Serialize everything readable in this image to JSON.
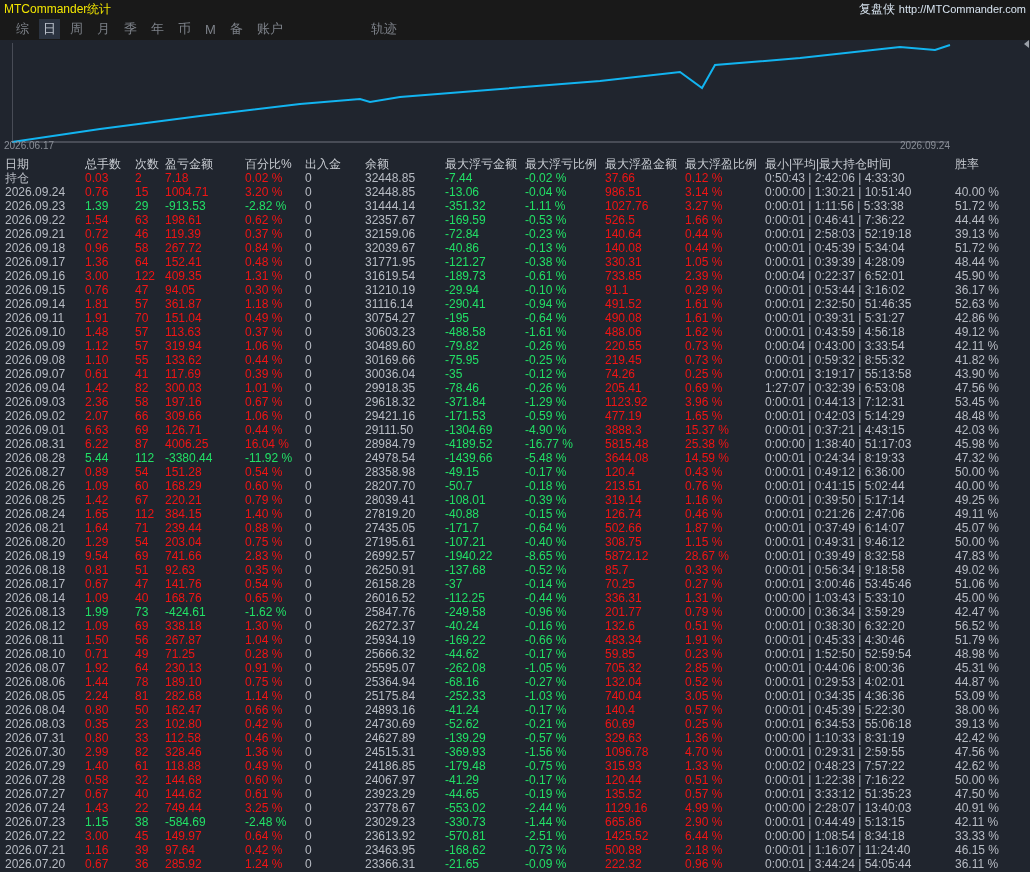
{
  "title": "MTCommander统计",
  "site": {
    "brand": "复盘侠",
    "url": "http://MTCommander.com"
  },
  "tabs": [
    {
      "label": "综",
      "selected": false
    },
    {
      "label": "日",
      "selected": true
    },
    {
      "label": "周",
      "selected": false
    },
    {
      "label": "月",
      "selected": false
    },
    {
      "label": "季",
      "selected": false
    },
    {
      "label": "年",
      "selected": false
    },
    {
      "label": "币",
      "selected": false
    },
    {
      "label": "M",
      "selected": false
    },
    {
      "label": "备",
      "selected": false
    },
    {
      "label": "账户",
      "selected": false
    },
    {
      "label": "轨迹",
      "selected": false
    }
  ],
  "equity_chart": {
    "start_label": "2026.06.17",
    "end_label": "2026.09.24"
  },
  "table": {
    "columns": [
      "日期",
      "总手数",
      "次数",
      "盈亏金额",
      "百分比%",
      "出入金",
      "余额",
      "最大浮亏金额",
      "最大浮亏比例",
      "最大浮盈金额",
      "最大浮盈比例",
      "最小|平均|最大持仓时间",
      "胜率"
    ],
    "rows": [
      {
        "loss": false,
        "cells": [
          "持仓",
          "0.03",
          "2",
          "7.18",
          "0.02 %",
          "0",
          "32448.85",
          "-7.44",
          "-0.02 %",
          "37.66",
          "0.12 %",
          "0:50:43 | 2:42:06 | 4:33:30"
        ]
      },
      {
        "loss": false,
        "cells": [
          "2026.09.24",
          "0.76",
          "15",
          "1004.71",
          "3.20 %",
          "0",
          "32448.85",
          "-13.06",
          "-0.04 %",
          "986.51",
          "3.14 %",
          "0:00:00 | 1:30:21 | 10:51:40",
          "40.00 %"
        ]
      },
      {
        "loss": true,
        "cells": [
          "2026.09.23",
          "1.39",
          "29",
          "-913.53",
          "-2.82 %",
          "0",
          "31444.14",
          "-351.32",
          "-1.11 %",
          "1027.76",
          "3.27 %",
          "0:00:01 | 1:11:56 | 5:33:38",
          "51.72 %"
        ]
      },
      {
        "loss": false,
        "cells": [
          "2026.09.22",
          "1.54",
          "63",
          "198.61",
          "0.62 %",
          "0",
          "32357.67",
          "-169.59",
          "-0.53 %",
          "526.5",
          "1.66 %",
          "0:00:01 | 0:46:41 | 7:36:22",
          "44.44 %"
        ]
      },
      {
        "loss": false,
        "cells": [
          "2026.09.21",
          "0.72",
          "46",
          "119.39",
          "0.37 %",
          "0",
          "32159.06",
          "-72.84",
          "-0.23 %",
          "140.64",
          "0.44 %",
          "0:00:01 | 2:58:03 | 52:19:18",
          "39.13 %"
        ]
      },
      {
        "loss": false,
        "cells": [
          "2026.09.18",
          "0.96",
          "58",
          "267.72",
          "0.84 %",
          "0",
          "32039.67",
          "-40.86",
          "-0.13 %",
          "140.08",
          "0.44 %",
          "0:00:01 | 0:45:39 | 5:34:04",
          "51.72 %"
        ]
      },
      {
        "loss": false,
        "cells": [
          "2026.09.17",
          "1.36",
          "64",
          "152.41",
          "0.48 %",
          "0",
          "31771.95",
          "-121.27",
          "-0.38 %",
          "330.31",
          "1.05 %",
          "0:00:01 | 0:39:39 | 4:28:09",
          "48.44 %"
        ]
      },
      {
        "loss": false,
        "cells": [
          "2026.09.16",
          "3.00",
          "122",
          "409.35",
          "1.31 %",
          "0",
          "31619.54",
          "-189.73",
          "-0.61 %",
          "733.85",
          "2.39 %",
          "0:00:04 | 0:22:37 | 6:52:01",
          "45.90 %"
        ]
      },
      {
        "loss": false,
        "cells": [
          "2026.09.15",
          "0.76",
          "47",
          "94.05",
          "0.30 %",
          "0",
          "31210.19",
          "-29.94",
          "-0.10 %",
          "91.1",
          "0.29 %",
          "0:00:01 | 0:53:44 | 3:16:02",
          "36.17 %"
        ]
      },
      {
        "loss": false,
        "cells": [
          "2026.09.14",
          "1.81",
          "57",
          "361.87",
          "1.18 %",
          "0",
          "31116.14",
          "-290.41",
          "-0.94 %",
          "491.52",
          "1.61 %",
          "0:00:01 | 2:32:50 | 51:46:35",
          "52.63 %"
        ]
      },
      {
        "loss": false,
        "cells": [
          "2026.09.11",
          "1.91",
          "70",
          "151.04",
          "0.49 %",
          "0",
          "30754.27",
          "-195",
          "-0.64 %",
          "490.08",
          "1.61 %",
          "0:00:01 | 0:39:31 | 5:31:27",
          "42.86 %"
        ]
      },
      {
        "loss": false,
        "cells": [
          "2026.09.10",
          "1.48",
          "57",
          "113.63",
          "0.37 %",
          "0",
          "30603.23",
          "-488.58",
          "-1.61 %",
          "488.06",
          "1.62 %",
          "0:00:01 | 0:43:59 | 4:56:18",
          "49.12 %"
        ]
      },
      {
        "loss": false,
        "cells": [
          "2026.09.09",
          "1.12",
          "57",
          "319.94",
          "1.06 %",
          "0",
          "30489.60",
          "-79.82",
          "-0.26 %",
          "220.55",
          "0.73 %",
          "0:00:04 | 0:43:00 | 3:33:54",
          "42.11 %"
        ]
      },
      {
        "loss": false,
        "cells": [
          "2026.09.08",
          "1.10",
          "55",
          "133.62",
          "0.44 %",
          "0",
          "30169.66",
          "-75.95",
          "-0.25 %",
          "219.45",
          "0.73 %",
          "0:00:01 | 0:59:32 | 8:55:32",
          "41.82 %"
        ]
      },
      {
        "loss": false,
        "cells": [
          "2026.09.07",
          "0.61",
          "41",
          "117.69",
          "0.39 %",
          "0",
          "30036.04",
          "-35",
          "-0.12 %",
          "74.26",
          "0.25 %",
          "0:00:01 | 3:19:17 | 55:13:58",
          "43.90 %"
        ]
      },
      {
        "loss": false,
        "cells": [
          "2026.09.04",
          "1.42",
          "82",
          "300.03",
          "1.01 %",
          "0",
          "29918.35",
          "-78.46",
          "-0.26 %",
          "205.41",
          "0.69 %",
          "1:27:07 | 0:32:39 | 6:53:08",
          "47.56 %"
        ]
      },
      {
        "loss": false,
        "cells": [
          "2026.09.03",
          "2.36",
          "58",
          "197.16",
          "0.67 %",
          "0",
          "29618.32",
          "-371.84",
          "-1.29 %",
          "1123.92",
          "3.96 %",
          "0:00:01 | 0:44:13 | 7:12:31",
          "53.45 %"
        ]
      },
      {
        "loss": false,
        "cells": [
          "2026.09.02",
          "2.07",
          "66",
          "309.66",
          "1.06 %",
          "0",
          "29421.16",
          "-171.53",
          "-0.59 %",
          "477.19",
          "1.65 %",
          "0:00:01 | 0:42:03 | 5:14:29",
          "48.48 %"
        ]
      },
      {
        "loss": false,
        "cells": [
          "2026.09.01",
          "6.63",
          "69",
          "126.71",
          "0.44 %",
          "0",
          "29111.50",
          "-1304.69",
          "-4.90 %",
          "3888.3",
          "15.37 %",
          "0:00:01 | 0:37:21 | 4:43:15",
          "42.03 %"
        ]
      },
      {
        "loss": false,
        "cells": [
          "2026.08.31",
          "6.22",
          "87",
          "4006.25",
          "16.04 %",
          "0",
          "28984.79",
          "-4189.52",
          "-16.77 %",
          "5815.48",
          "25.38 %",
          "0:00:00 | 1:38:40 | 51:17:03",
          "45.98 %"
        ]
      },
      {
        "loss": true,
        "cells": [
          "2026.08.28",
          "5.44",
          "112",
          "-3380.44",
          "-11.92 %",
          "0",
          "24978.54",
          "-1439.66",
          "-5.48 %",
          "3644.08",
          "14.59 %",
          "0:00:01 | 0:24:34 | 8:19:33",
          "47.32 %"
        ]
      },
      {
        "loss": false,
        "cells": [
          "2026.08.27",
          "0.89",
          "54",
          "151.28",
          "0.54 %",
          "0",
          "28358.98",
          "-49.15",
          "-0.17 %",
          "120.4",
          "0.43 %",
          "0:00:01 | 0:49:12 | 6:36:00",
          "50.00 %"
        ]
      },
      {
        "loss": false,
        "cells": [
          "2026.08.26",
          "1.09",
          "60",
          "168.29",
          "0.60 %",
          "0",
          "28207.70",
          "-50.7",
          "-0.18 %",
          "213.51",
          "0.76 %",
          "0:00:01 | 0:41:15 | 5:02:44",
          "40.00 %"
        ]
      },
      {
        "loss": false,
        "cells": [
          "2026.08.25",
          "1.42",
          "67",
          "220.21",
          "0.79 %",
          "0",
          "28039.41",
          "-108.01",
          "-0.39 %",
          "319.14",
          "1.16 %",
          "0:00:01 | 0:39:50 | 5:17:14",
          "49.25 %"
        ]
      },
      {
        "loss": false,
        "cells": [
          "2026.08.24",
          "1.65",
          "112",
          "384.15",
          "1.40 %",
          "0",
          "27819.20",
          "-40.88",
          "-0.15 %",
          "126.74",
          "0.46 %",
          "0:00:01 | 0:21:26 | 2:47:06",
          "49.11 %"
        ]
      },
      {
        "loss": false,
        "cells": [
          "2026.08.21",
          "1.64",
          "71",
          "239.44",
          "0.88 %",
          "0",
          "27435.05",
          "-171.7",
          "-0.64 %",
          "502.66",
          "1.87 %",
          "0:00:01 | 0:37:49 | 6:14:07",
          "45.07 %"
        ]
      },
      {
        "loss": false,
        "cells": [
          "2026.08.20",
          "1.29",
          "54",
          "203.04",
          "0.75 %",
          "0",
          "27195.61",
          "-107.21",
          "-0.40 %",
          "308.75",
          "1.15 %",
          "0:00:01 | 0:49:31 | 9:46:12",
          "50.00 %"
        ]
      },
      {
        "loss": false,
        "cells": [
          "2026.08.19",
          "9.54",
          "69",
          "741.66",
          "2.83 %",
          "0",
          "26992.57",
          "-1940.22",
          "-8.65 %",
          "5872.12",
          "28.67 %",
          "0:00:01 | 0:39:49 | 8:32:58",
          "47.83 %"
        ]
      },
      {
        "loss": false,
        "cells": [
          "2026.08.18",
          "0.81",
          "51",
          "92.63",
          "0.35 %",
          "0",
          "26250.91",
          "-137.68",
          "-0.52 %",
          "85.7",
          "0.33 %",
          "0:00:01 | 0:56:34 | 9:18:58",
          "49.02 %"
        ]
      },
      {
        "loss": false,
        "cells": [
          "2026.08.17",
          "0.67",
          "47",
          "141.76",
          "0.54 %",
          "0",
          "26158.28",
          "-37",
          "-0.14 %",
          "70.25",
          "0.27 %",
          "0:00:01 | 3:00:46 | 53:45:46",
          "51.06 %"
        ]
      },
      {
        "loss": false,
        "cells": [
          "2026.08.14",
          "1.09",
          "40",
          "168.76",
          "0.65 %",
          "0",
          "26016.52",
          "-112.25",
          "-0.44 %",
          "336.31",
          "1.31 %",
          "0:00:00 | 1:03:43 | 5:33:10",
          "45.00 %"
        ]
      },
      {
        "loss": true,
        "cells": [
          "2026.08.13",
          "1.99",
          "73",
          "-424.61",
          "-1.62 %",
          "0",
          "25847.76",
          "-249.58",
          "-0.96 %",
          "201.77",
          "0.79 %",
          "0:00:00 | 0:36:34 | 3:59:29",
          "42.47 %"
        ]
      },
      {
        "loss": false,
        "cells": [
          "2026.08.12",
          "1.09",
          "69",
          "338.18",
          "1.30 %",
          "0",
          "26272.37",
          "-40.24",
          "-0.16 %",
          "132.6",
          "0.51 %",
          "0:00:01 | 0:38:30 | 6:32:20",
          "56.52 %"
        ]
      },
      {
        "loss": false,
        "cells": [
          "2026.08.11",
          "1.50",
          "56",
          "267.87",
          "1.04 %",
          "0",
          "25934.19",
          "-169.22",
          "-0.66 %",
          "483.34",
          "1.91 %",
          "0:00:01 | 0:45:33 | 4:30:46",
          "51.79 %"
        ]
      },
      {
        "loss": false,
        "cells": [
          "2026.08.10",
          "0.71",
          "49",
          "71.25",
          "0.28 %",
          "0",
          "25666.32",
          "-44.62",
          "-0.17 %",
          "59.85",
          "0.23 %",
          "0:00:01 | 1:52:50 | 52:59:54",
          "48.98 %"
        ]
      },
      {
        "loss": false,
        "cells": [
          "2026.08.07",
          "1.92",
          "64",
          "230.13",
          "0.91 %",
          "0",
          "25595.07",
          "-262.08",
          "-1.05 %",
          "705.32",
          "2.85 %",
          "0:00:01 | 0:44:06 | 8:00:36",
          "45.31 %"
        ]
      },
      {
        "loss": false,
        "cells": [
          "2026.08.06",
          "1.44",
          "78",
          "189.10",
          "0.75 %",
          "0",
          "25364.94",
          "-68.16",
          "-0.27 %",
          "132.04",
          "0.52 %",
          "0:00:01 | 0:29:53 | 4:02:01",
          "44.87 %"
        ]
      },
      {
        "loss": false,
        "cells": [
          "2026.08.05",
          "2.24",
          "81",
          "282.68",
          "1.14 %",
          "0",
          "25175.84",
          "-252.33",
          "-1.03 %",
          "740.04",
          "3.05 %",
          "0:00:01 | 0:34:35 | 4:36:36",
          "53.09 %"
        ]
      },
      {
        "loss": false,
        "cells": [
          "2026.08.04",
          "0.80",
          "50",
          "162.47",
          "0.66 %",
          "0",
          "24893.16",
          "-41.24",
          "-0.17 %",
          "140.4",
          "0.57 %",
          "0:00:01 | 0:45:39 | 5:22:30",
          "38.00 %"
        ]
      },
      {
        "loss": false,
        "cells": [
          "2026.08.03",
          "0.35",
          "23",
          "102.80",
          "0.42 %",
          "0",
          "24730.69",
          "-52.62",
          "-0.21 %",
          "60.69",
          "0.25 %",
          "0:00:01 | 6:34:53 | 55:06:18",
          "39.13 %"
        ]
      },
      {
        "loss": false,
        "cells": [
          "2026.07.31",
          "0.80",
          "33",
          "112.58",
          "0.46 %",
          "0",
          "24627.89",
          "-139.29",
          "-0.57 %",
          "329.63",
          "1.36 %",
          "0:00:00 | 1:10:33 | 8:31:19",
          "42.42 %"
        ]
      },
      {
        "loss": false,
        "cells": [
          "2026.07.30",
          "2.99",
          "82",
          "328.46",
          "1.36 %",
          "0",
          "24515.31",
          "-369.93",
          "-1.56 %",
          "1096.78",
          "4.70 %",
          "0:00:01 | 0:29:31 | 2:59:55",
          "47.56 %"
        ]
      },
      {
        "loss": false,
        "cells": [
          "2026.07.29",
          "1.40",
          "61",
          "118.88",
          "0.49 %",
          "0",
          "24186.85",
          "-179.48",
          "-0.75 %",
          "315.93",
          "1.33 %",
          "0:00:02 | 0:48:23 | 7:57:22",
          "42.62 %"
        ]
      },
      {
        "loss": false,
        "cells": [
          "2026.07.28",
          "0.58",
          "32",
          "144.68",
          "0.60 %",
          "0",
          "24067.97",
          "-41.29",
          "-0.17 %",
          "120.44",
          "0.51 %",
          "0:00:01 | 1:22:38 | 7:16:22",
          "50.00 %"
        ]
      },
      {
        "loss": false,
        "cells": [
          "2026.07.27",
          "0.67",
          "40",
          "144.62",
          "0.61 %",
          "0",
          "23923.29",
          "-44.65",
          "-0.19 %",
          "135.52",
          "0.57 %",
          "0:00:01 | 3:33:12 | 51:35:23",
          "47.50 %"
        ]
      },
      {
        "loss": false,
        "cells": [
          "2026.07.24",
          "1.43",
          "22",
          "749.44",
          "3.25 %",
          "0",
          "23778.67",
          "-553.02",
          "-2.44 %",
          "1129.16",
          "4.99 %",
          "0:00:00 | 2:28:07 | 13:40:03",
          "40.91 %"
        ]
      },
      {
        "loss": true,
        "cells": [
          "2026.07.23",
          "1.15",
          "38",
          "-584.69",
          "-2.48 %",
          "0",
          "23029.23",
          "-330.73",
          "-1.44 %",
          "665.86",
          "2.90 %",
          "0:00:01 | 0:44:49 | 5:13:15",
          "42.11 %"
        ]
      },
      {
        "loss": false,
        "cells": [
          "2026.07.22",
          "3.00",
          "45",
          "149.97",
          "0.64 %",
          "0",
          "23613.92",
          "-570.81",
          "-2.51 %",
          "1425.52",
          "6.44 %",
          "0:00:00 | 1:08:54 | 8:34:18",
          "33.33 %"
        ]
      },
      {
        "loss": false,
        "cells": [
          "2026.07.21",
          "1.16",
          "39",
          "97.64",
          "0.42 %",
          "0",
          "23463.95",
          "-168.62",
          "-0.73 %",
          "500.88",
          "2.18 %",
          "0:00:01 | 1:16:07 | 11:24:40",
          "46.15 %"
        ]
      },
      {
        "loss": false,
        "cells": [
          "2026.07.20",
          "0.67",
          "36",
          "285.92",
          "1.24 %",
          "0",
          "23366.31",
          "-21.65",
          "-0.09 %",
          "222.32",
          "0.96 %",
          "0:00:01 | 3:44:24 | 54:05:44",
          "36.11 %"
        ]
      }
    ]
  }
}
